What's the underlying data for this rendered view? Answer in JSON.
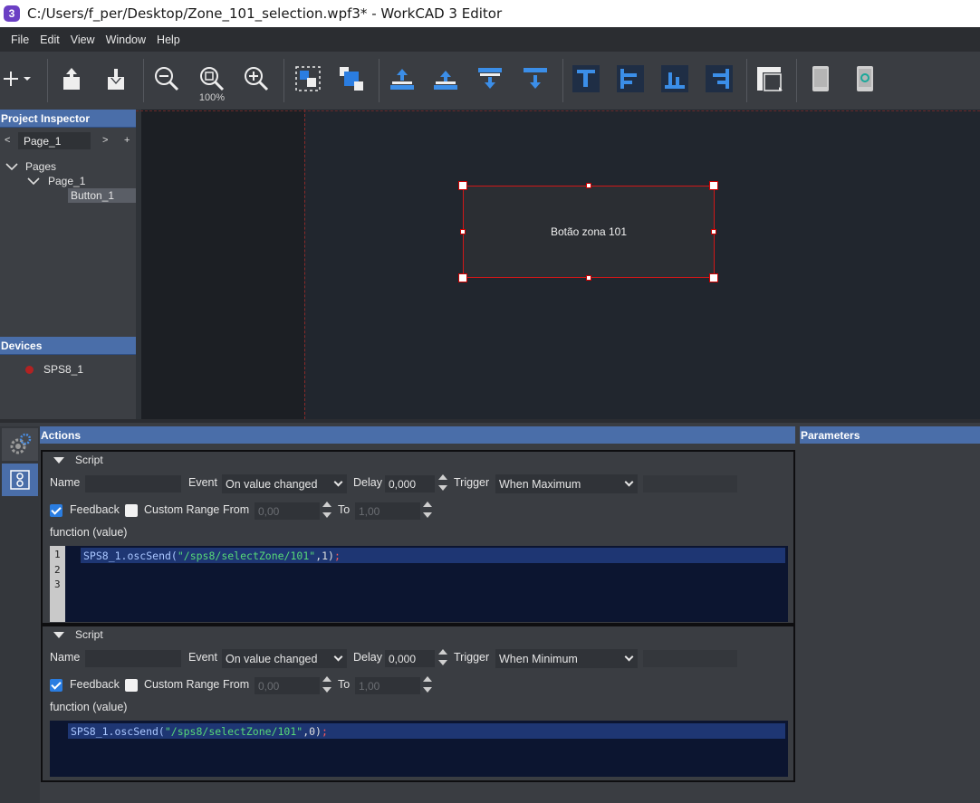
{
  "window": {
    "title": "C:/Users/f_per/Desktop/Zone_101_selection.wpf3* - WorkCAD 3 Editor",
    "app_icon": "3"
  },
  "menu": [
    "File",
    "Edit",
    "View",
    "Window",
    "Help"
  ],
  "toolbar": {
    "zoom_level": "100%",
    "icons": [
      "add-icon",
      "export-icon",
      "import-icon",
      "zoom-out-icon",
      "zoom-fit-icon",
      "zoom-in-icon",
      "bring-front-icon",
      "send-back-icon",
      "align-top-icon",
      "align-middle-icon",
      "align-bottom-icon",
      "distribute-icon",
      "align-left-icon",
      "align-center-icon",
      "align-baseline-icon",
      "align-right-icon",
      "layout-icon",
      "device-preview-icon",
      "device-refresh-icon"
    ]
  },
  "project_inspector": {
    "header": "Project Inspector",
    "nav_prev": "<",
    "current_page": "Page_1",
    "nav_next": ">",
    "nav_add": "+",
    "tree": {
      "root": "Pages",
      "page": "Page_1",
      "item": "Button_1"
    }
  },
  "devices": {
    "header": "Devices",
    "items": [
      {
        "name": "SPS8_1",
        "status_color": "#b22222"
      }
    ]
  },
  "canvas": {
    "widget_label": "Botão zona 101"
  },
  "actions": {
    "header": "Actions",
    "labels": {
      "name": "Name",
      "event": "Event",
      "delay": "Delay",
      "trigger": "Trigger",
      "feedback": "Feedback",
      "custom_range": "Custom Range",
      "from": "From",
      "to": "To",
      "function_sig": "function (value)"
    },
    "scripts": [
      {
        "title": "Script",
        "name_value": "",
        "event": "On value changed",
        "delay": "0,000",
        "trigger": "When Maximum",
        "feedback": true,
        "custom_range": false,
        "from": "0,00",
        "to": "1,00",
        "line_numbers": [
          "1",
          "2",
          "3"
        ],
        "code": {
          "id": "SPS8_1.oscSend(",
          "str": "\"/sps8/selectZone/101\"",
          "rest": ",1)",
          "semi": ";"
        }
      },
      {
        "title": "Script",
        "name_value": "",
        "event": "On value changed",
        "delay": "0,000",
        "trigger": "When Minimum",
        "feedback": true,
        "custom_range": false,
        "from": "0,00",
        "to": "1,00",
        "code": {
          "id": "SPS8_1.oscSend(",
          "str": "\"/sps8/selectZone/101\"",
          "rest": ",0)",
          "semi": ";"
        }
      }
    ]
  },
  "parameters": {
    "header": "Parameters"
  },
  "colors": {
    "accent": "#4a6ea9",
    "selection": "#d01818",
    "checkbox": "#2a7de1",
    "code_bg": "#0c1530"
  }
}
